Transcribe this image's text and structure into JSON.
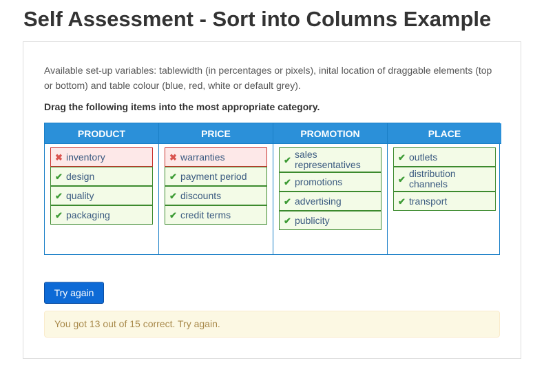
{
  "page": {
    "title": "Self Assessment - Sort into Columns Example"
  },
  "intro_text": "Available set-up variables: tablewidth (in percentages or pixels), inital location of draggable elements (top or bottom) and table colour (blue, red, white or default grey).",
  "instruction": "Drag the following items into the most appropriate category.",
  "columns": [
    {
      "header": "PRODUCT",
      "items": [
        {
          "label": "inventory",
          "status": "wrong"
        },
        {
          "label": "design",
          "status": "correct"
        },
        {
          "label": "quality",
          "status": "correct"
        },
        {
          "label": "packaging",
          "status": "correct"
        }
      ]
    },
    {
      "header": "PRICE",
      "items": [
        {
          "label": "warranties",
          "status": "wrong"
        },
        {
          "label": "payment period",
          "status": "correct"
        },
        {
          "label": "discounts",
          "status": "correct"
        },
        {
          "label": "credit terms",
          "status": "correct"
        }
      ]
    },
    {
      "header": "PROMOTION",
      "items": [
        {
          "label": "sales representatives",
          "status": "correct"
        },
        {
          "label": "promotions",
          "status": "correct"
        },
        {
          "label": "advertising",
          "status": "correct"
        },
        {
          "label": "publicity",
          "status": "correct"
        }
      ]
    },
    {
      "header": "PLACE",
      "items": [
        {
          "label": "outlets",
          "status": "correct"
        },
        {
          "label": "distribution channels",
          "status": "correct"
        },
        {
          "label": "transport",
          "status": "correct"
        }
      ]
    }
  ],
  "icons": {
    "correct": "check-icon",
    "wrong": "cross-icon"
  },
  "try_again_label": "Try again",
  "result_text": "You got 13 out of 15 correct. Try again.",
  "colors": {
    "header_blue": "#2b90d9",
    "correct_border": "#3c8a2e",
    "wrong_border": "#c9302c",
    "button_blue": "#0d6ad6",
    "alert_bg": "#fcf8e3"
  }
}
